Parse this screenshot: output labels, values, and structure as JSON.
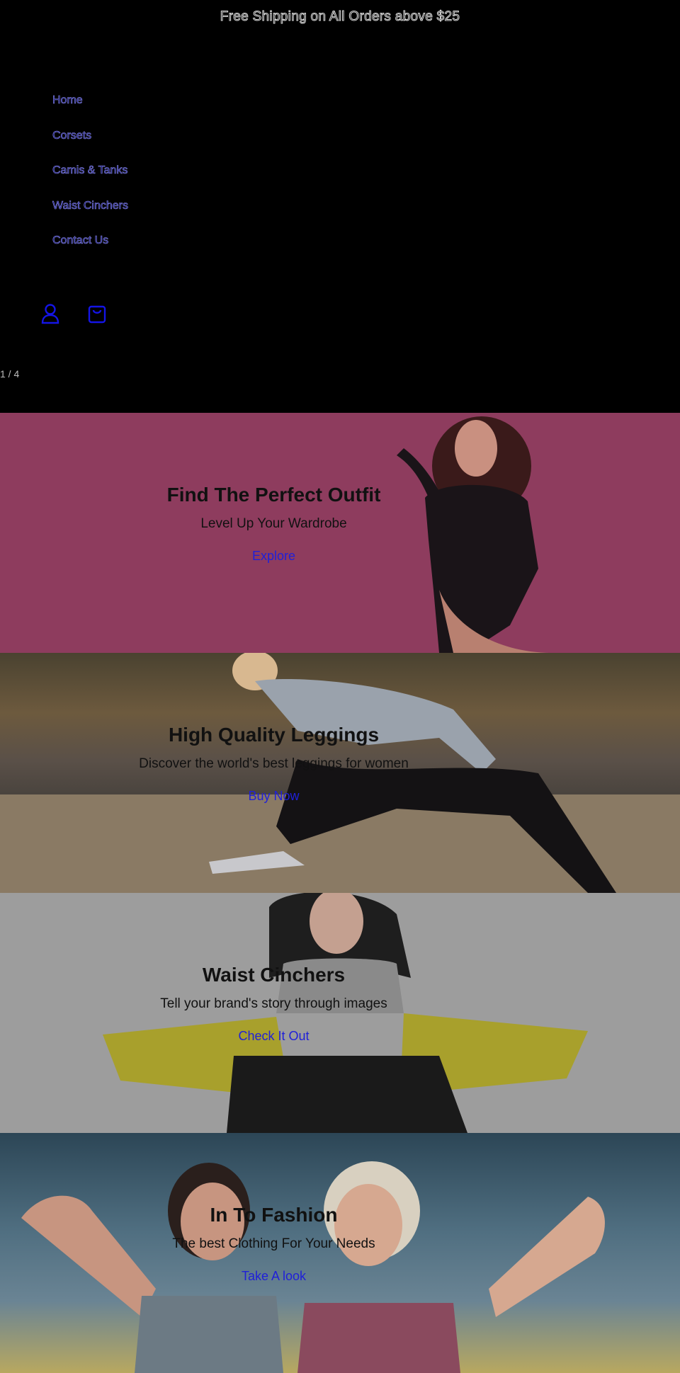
{
  "announcement": "Free Shipping on All Orders above $25",
  "nav": {
    "items": [
      "Home",
      "Corsets",
      "Camis & Tanks",
      "Waist Cinchers",
      "Contact Us"
    ]
  },
  "header_icons": [
    "account-icon",
    "cart-icon"
  ],
  "slideshow": {
    "counter": "1 / 4",
    "slides": [
      {
        "heading": "Find The Perfect Outfit",
        "subheading": "Level Up Your Wardrobe",
        "cta": "Explore"
      },
      {
        "heading": "High Quality Leggings",
        "subheading": "Discover the world's best leggings for women",
        "cta": "Buy Now"
      },
      {
        "heading": "Waist Cinchers",
        "subheading": "Tell your brand's story through images",
        "cta": "Check It Out"
      },
      {
        "heading": "In To Fashion",
        "subheading": "The best Clothing For Your Needs",
        "cta": "Take A look"
      }
    ]
  },
  "colors": {
    "background": "#000000",
    "link": "#2020d8",
    "slide1_bg": "#8e3c5e",
    "slide3_bg": "#9d9d9d"
  }
}
